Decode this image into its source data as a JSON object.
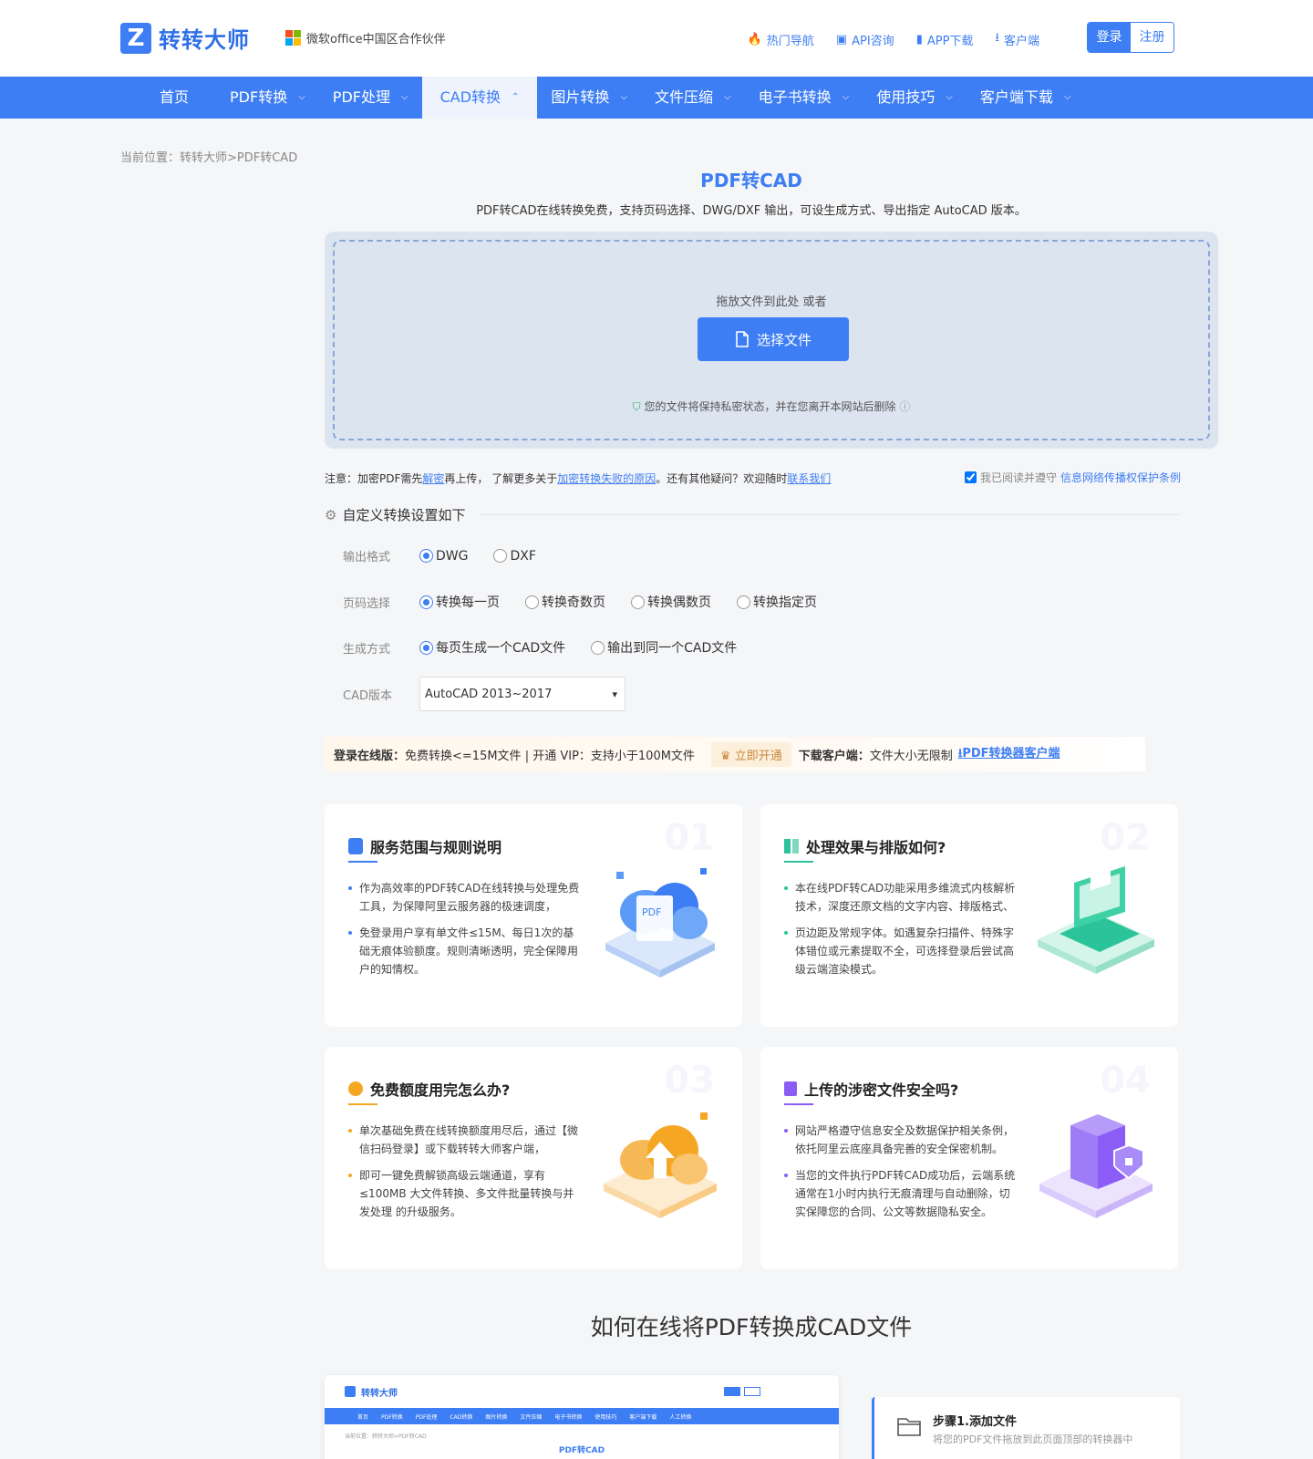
{
  "header": {
    "logo_mark": "Z",
    "logo_text": "转转大师",
    "partner": "微软office中国区合作伙伴",
    "top_links": [
      {
        "icon": "flame-icon",
        "glyph": "🔥",
        "label": "热门导航"
      },
      {
        "icon": "chat-icon",
        "glyph": "▣",
        "label": "API咨询"
      },
      {
        "icon": "phone-icon",
        "glyph": "▮",
        "label": "APP下载"
      },
      {
        "icon": "download-icon",
        "glyph": "⭳",
        "label": "客户端"
      }
    ],
    "login": "登录",
    "register": "注册"
  },
  "nav": [
    {
      "label": "首页",
      "chevron": ""
    },
    {
      "label": "PDF转换",
      "chevron": "⌵"
    },
    {
      "label": "PDF处理",
      "chevron": "⌵"
    },
    {
      "label": "CAD转换",
      "chevron": "⌃",
      "active": true
    },
    {
      "label": "图片转换",
      "chevron": "⌵"
    },
    {
      "label": "文件压缩",
      "chevron": "⌵"
    },
    {
      "label": "电子书转换",
      "chevron": "⌵"
    },
    {
      "label": "使用技巧",
      "chevron": "⌵"
    },
    {
      "label": "客户端下载",
      "chevron": "⌵"
    }
  ],
  "breadcrumb": "当前位置：转转大师>PDF转CAD",
  "page_title": "PDF转CAD",
  "subtitle": "PDF转CAD在线转换免费，支持页码选择、DWG/DXF 输出，可设生成方式、导出指定 AutoCAD 版本。",
  "upload": {
    "hint": "拖放文件到此处 或者",
    "button": "选择文件",
    "privacy": "您的文件将保持私密状态，并在您离开本网站后删除"
  },
  "notice": {
    "p1": "注意：加密PDF需先",
    "l1": "解密",
    "p2": "再上传， 了解更多关于",
    "l2": "加密转换失败的原因",
    "p3": "。还有其他疑问？欢迎随时",
    "l3": "联系我们"
  },
  "agree": {
    "text": "我已阅读并遵守",
    "link": "信息网络传播权保护条例",
    "checked": true
  },
  "settings": {
    "heading": "自定义转换设置如下",
    "output_label": "输出格式",
    "output_options": [
      "DWG",
      "DXF"
    ],
    "output_selected": "DWG",
    "page_label": "页码选择",
    "page_options": [
      "转换每一页",
      "转换奇数页",
      "转换偶数页",
      "转换指定页"
    ],
    "page_selected": "转换每一页",
    "mode_label": "生成方式",
    "mode_options": [
      "每页生成一个CAD文件",
      "输出到同一个CAD文件"
    ],
    "mode_selected": "每页生成一个CAD文件",
    "version_label": "CAD版本",
    "version_value": "AutoCAD 2013~2017"
  },
  "promo": {
    "b1": "登录在线版：",
    "t1": "免费转换<=15M文件 | 开通 VIP：支持小于100M文件",
    "vip": "立即开通",
    "b2": "下载客户端：",
    "t2": "文件大小无限制",
    "link": "PDF转换器客户端"
  },
  "cards": [
    {
      "num": "01",
      "title": "服务范围与规则说明",
      "accent": "#3e7ef4",
      "items": [
        "作为高效率的PDF转CAD在线转换与处理免费工具，为保障阿里云服务器的极速调度，",
        "免登录用户享有单文件≤15M、每日1次的基础无痕体验额度。规则清晰透明，完全保障用户的知情权。"
      ]
    },
    {
      "num": "02",
      "title": "处理效果与排版如何?",
      "accent": "#2bc49a",
      "items": [
        "本在线PDF转CAD功能采用多维流式内核解析技术，深度还原文档的文字内容、排版格式、",
        "页边距及常规字体。如遇复杂扫描件、特殊字体错位或元素提取不全，可选择登录后尝试高级云端渲染模式。"
      ]
    },
    {
      "num": "03",
      "title": "免费额度用完怎么办?",
      "accent": "#f5a623",
      "items": [
        "单次基础免费在线转换额度用尽后，通过【微信扫码登录】或下载转转大师客户端，",
        "即可一键免费解锁高级云端通道，享有≤100MB 大文件转换、多文件批量转换与并发处理 的升级服务。"
      ]
    },
    {
      "num": "04",
      "title": "上传的涉密文件安全吗?",
      "accent": "#8b5cf6",
      "items": [
        "网站严格遵守信息安全及数据保护相关条例，依托阿里云底座具备完善的安全保密机制。",
        "当您的文件执行PDF转CAD成功后，云端系统通常在1小时内执行无痕清理与自动删除，切实保障您的合同、公文等数据隐私安全。"
      ]
    }
  ],
  "howto_title": "如何在线将PDF转换成CAD文件",
  "screenshot": {
    "logo": "转转大师",
    "nav": [
      "首页",
      "PDF转换",
      "PDF处理",
      "CAD转换",
      "图片转换",
      "文件压缩",
      "电子书转换",
      "使用技巧",
      "客户端下载",
      "人工转换"
    ],
    "breadcrumb": "当前位置：转转大师>PDF转CAD",
    "title": "PDF转CAD"
  },
  "step": {
    "title": "步骤1.添加文件",
    "desc": "将您的PDF文件拖放到此页面顶部的转换器中"
  },
  "colors": {
    "primary": "#3e7ef4",
    "nav_bg": "#3e7ef4",
    "success": "#2db35e",
    "vip": "#c8873a"
  }
}
